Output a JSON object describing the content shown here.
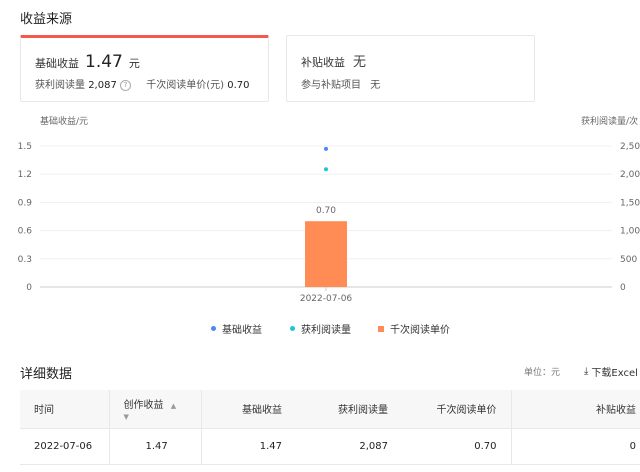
{
  "section": {
    "title": "收益来源"
  },
  "cards": {
    "base": {
      "label": "基础收益",
      "value": "1.47",
      "unit": "元",
      "reads_label": "获利阅读量",
      "reads_value": "2,087",
      "cpm_label": "千次阅读单价(元)",
      "cpm_value": "0.70"
    },
    "subsidy": {
      "label": "补贴收益",
      "value": "无",
      "project_label": "参与补贴项目",
      "project_value": "无"
    }
  },
  "chart_data": {
    "type": "bar",
    "left_axis_label": "基础收益/元",
    "right_axis_label": "获利阅读量/次",
    "left_ticks": [
      "1.5",
      "1.2",
      "0.9",
      "0.6",
      "0.3",
      "0"
    ],
    "right_ticks": [
      "2,500",
      "2,000",
      "1,500",
      "1,000",
      "500",
      "0"
    ],
    "left_ylim": [
      0,
      1.5
    ],
    "right_ylim": [
      0,
      2500
    ],
    "categories": [
      "2022-07-06"
    ],
    "series": [
      {
        "name": "基础收益",
        "type": "scatter",
        "axis": "left",
        "values": [
          1.47
        ],
        "color": "#4f86f7"
      },
      {
        "name": "获利阅读量",
        "type": "scatter",
        "axis": "right",
        "values": [
          2087
        ],
        "color": "#1bc6d6"
      },
      {
        "name": "千次阅读单价",
        "type": "bar",
        "axis": "left",
        "values": [
          0.7
        ],
        "color": "#ff8c55",
        "data_label": "0.70"
      }
    ],
    "legend_position": "bottom"
  },
  "detail": {
    "title": "详细数据",
    "unit_label": "单位：元",
    "download_label": "下载Excel",
    "columns": [
      "时间",
      "创作收益",
      "基础收益",
      "获利阅读量",
      "千次阅读单价",
      "补贴收益"
    ],
    "rows": [
      [
        "2022-07-06",
        "1.47",
        "1.47",
        "2,087",
        "0.70",
        "0"
      ]
    ]
  }
}
